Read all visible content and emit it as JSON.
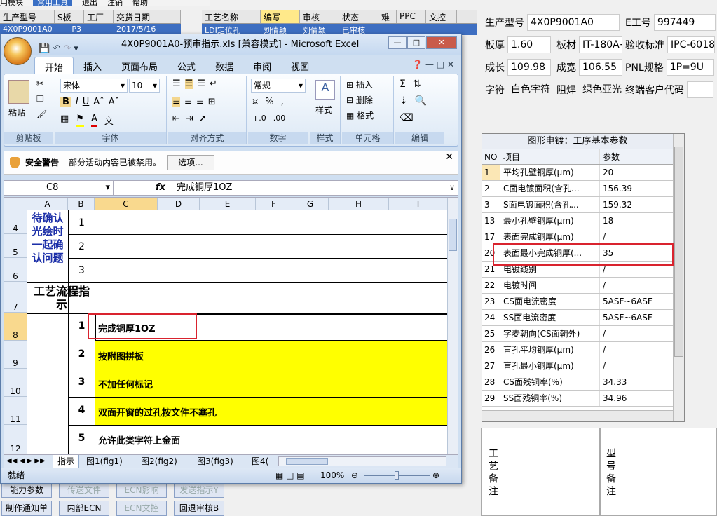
{
  "app": {
    "menu": [
      "用模块",
      "常用工具",
      "退出",
      "注销",
      "帮助"
    ],
    "left_table": {
      "headers": [
        "生产型号",
        "S板",
        "工厂",
        "交货日期"
      ],
      "row": [
        "4X0P9001A0",
        "P3",
        "",
        "2017/5/16"
      ]
    },
    "mid_table": {
      "headers": [
        "工艺名称",
        "编写",
        "审核",
        "状态",
        "难",
        "PPC",
        "文控"
      ],
      "row": [
        "LDI定位孔",
        "刘倩颖",
        "刘倩颖",
        "已审核",
        "",
        "",
        ""
      ]
    },
    "right_info": {
      "row1": {
        "l1": "生产型号",
        "v1": "4X0P9001A0",
        "l2": "E工号",
        "v2": "997449"
      },
      "row2": {
        "l1": "板厚",
        "v1": "1.60",
        "l2": "板材",
        "v2": "IT-180A+",
        "l3": "验收标准",
        "v3": "IPC-6018"
      },
      "row3": {
        "l1": "成长",
        "v1": "109.98",
        "l2": "成宽",
        "v2": "106.55",
        "l3": "PNL规格",
        "v3": "1P=9U"
      },
      "row4": {
        "l1": "字符",
        "v1": "白色字符",
        "l2": "阻焊",
        "v2": "绿色亚光",
        "l3": "终端客户代码",
        "v3": ""
      }
    },
    "param_grid": {
      "title": "图形电镀：工序基本参数",
      "headers": [
        "NO",
        "项目",
        "参数"
      ],
      "rows": [
        {
          "no": "1",
          "item": "平均孔壁铜厚(μm)",
          "param": "20"
        },
        {
          "no": "2",
          "item": "C面电镀面积(含孔...",
          "param": "156.39"
        },
        {
          "no": "3",
          "item": "S面电镀面积(含孔...",
          "param": "159.32"
        },
        {
          "no": "13",
          "item": "最小孔壁铜厚(μm)",
          "param": "18"
        },
        {
          "no": "17",
          "item": "表面完成铜厚(μm)",
          "param": "/"
        },
        {
          "no": "20",
          "item": "表面最小完成铜厚(...",
          "param": "35"
        },
        {
          "no": "21",
          "item": "电镀线别",
          "param": "/"
        },
        {
          "no": "22",
          "item": "电镀时间",
          "param": "/"
        },
        {
          "no": "23",
          "item": "CS面电流密度",
          "param": "5ASF~6ASF"
        },
        {
          "no": "24",
          "item": "SS面电流密度",
          "param": "5ASF~6ASF"
        },
        {
          "no": "25",
          "item": "字麦朝向(CS面朝外)",
          "param": "/"
        },
        {
          "no": "26",
          "item": "盲孔平均铜厚(μm)",
          "param": "/"
        },
        {
          "no": "27",
          "item": "盲孔最小铜厚(μm)",
          "param": "/"
        },
        {
          "no": "28",
          "item": "CS面残铜率(%)",
          "param": "34.33"
        },
        {
          "no": "29",
          "item": "SS面残铜率(%)",
          "param": "34.96"
        }
      ]
    },
    "notes": {
      "left": "工艺备注",
      "right": "型号备注"
    },
    "buttons": {
      "b1": "能力参数",
      "b2": "传送文件",
      "b3": "ECN影响",
      "b4": "发送指示Y",
      "b5": "制作通知单",
      "b6": "内部ECN",
      "b7": "ECN文控",
      "b8": "回退审核B"
    }
  },
  "excel": {
    "title": "4X0P9001A0-预审指示.xls  [兼容模式] - Microsoft Excel",
    "tabs": [
      "开始",
      "插入",
      "页面布局",
      "公式",
      "数据",
      "审阅",
      "视图"
    ],
    "font_name": "宋体",
    "font_size": "10",
    "number_format": "常规",
    "groups": [
      "剪贴板",
      "字体",
      "对齐方式",
      "数字",
      "样式",
      "单元格",
      "编辑"
    ],
    "paste_label": "粘贴",
    "style_label": "样式",
    "cells_buttons": [
      "插入",
      "删除",
      "格式"
    ],
    "warning_title": "安全警告",
    "warning_text": "部分活动内容已被禁用。",
    "options_button": "选项...",
    "name_box": "C8",
    "fx": "fx",
    "formula": "完成铜厚1OZ",
    "columns": [
      "A",
      "B",
      "C",
      "D",
      "E",
      "F",
      "G",
      "H",
      "I"
    ],
    "rows": [
      "4",
      "5",
      "6",
      "7",
      "8",
      "9",
      "10",
      "11",
      "12"
    ],
    "a_block_text": "待确认光绘时一起确认问题",
    "a7_text": "工艺流程指示",
    "b_nums": [
      "1",
      "2",
      "3",
      "1",
      "2",
      "3",
      "4",
      "5"
    ],
    "c_texts": [
      "完成铜厚1OZ",
      "按附图拼板",
      "不加任何标记",
      "双面开窗的过孔按文件不塞孔",
      "允许此类字符上金面"
    ],
    "sheet_tabs": [
      "指示",
      "图1(fig1)",
      "图2(fig2)",
      "图3(fig3)",
      "图4("
    ],
    "status_text": "就绪",
    "zoom": "100%",
    "highlight_color": "#ffff00"
  }
}
